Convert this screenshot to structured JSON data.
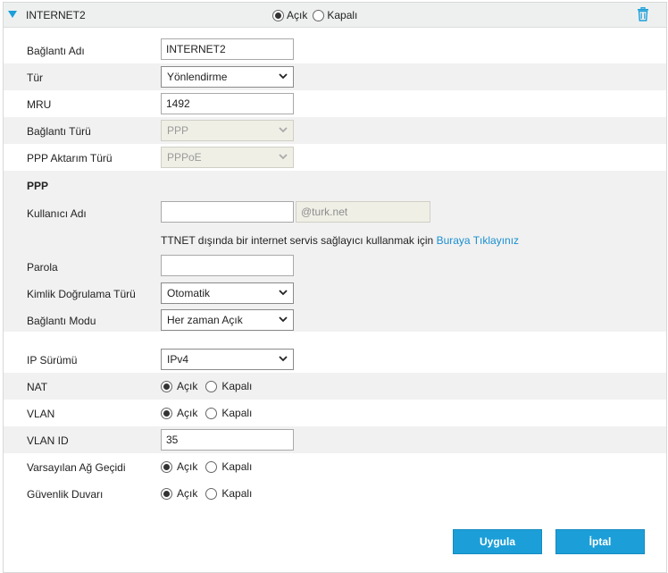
{
  "header": {
    "title": "INTERNET2",
    "options": [
      "Açık",
      "Kapalı"
    ],
    "selected": "Açık"
  },
  "fields": {
    "connection_name": {
      "label": "Bağlantı Adı",
      "value": "INTERNET2"
    },
    "type": {
      "label": "Tür",
      "value": "Yönlendirme"
    },
    "mru": {
      "label": "MRU",
      "value": "1492"
    },
    "connection_type": {
      "label": "Bağlantı Türü",
      "value": "PPP"
    },
    "ppp_transport": {
      "label": "PPP Aktarım Türü",
      "value": "PPPoE"
    }
  },
  "ppp": {
    "section_title": "PPP",
    "username": {
      "label": "Kullanıcı Adı",
      "value": "",
      "suffix": "@turk.net"
    },
    "note_text": "TTNET dışında bir internet servis sağlayıcı kullanmak için ",
    "note_link": "Buraya Tıklayınız",
    "password": {
      "label": "Parola",
      "value": ""
    },
    "auth_type": {
      "label": "Kimlik Doğrulama Türü",
      "value": "Otomatik"
    },
    "connection_mode": {
      "label": "Bağlantı Modu",
      "value": "Her zaman Açık"
    }
  },
  "network": {
    "ip_version": {
      "label": "IP Sürümü",
      "value": "IPv4"
    },
    "nat": {
      "label": "NAT",
      "selected": "Açık"
    },
    "vlan": {
      "label": "VLAN",
      "selected": "Açık"
    },
    "vlan_id": {
      "label": "VLAN ID",
      "value": "35"
    },
    "default_gateway": {
      "label": "Varsayılan Ağ Geçidi",
      "selected": "Açık"
    },
    "firewall": {
      "label": "Güvenlik Duvarı",
      "selected": "Açık"
    }
  },
  "radio_options": {
    "on": "Açık",
    "off": "Kapalı"
  },
  "buttons": {
    "apply": "Uygula",
    "cancel": "İptal"
  },
  "colors": {
    "accent": "#1c9fd8",
    "link": "#1a8fd0",
    "row_shade": "#f1f1f1"
  },
  "icons": {
    "collapse": "triangle-down-icon",
    "delete": "trash-icon",
    "dropdown": "chevron-down-icon"
  }
}
